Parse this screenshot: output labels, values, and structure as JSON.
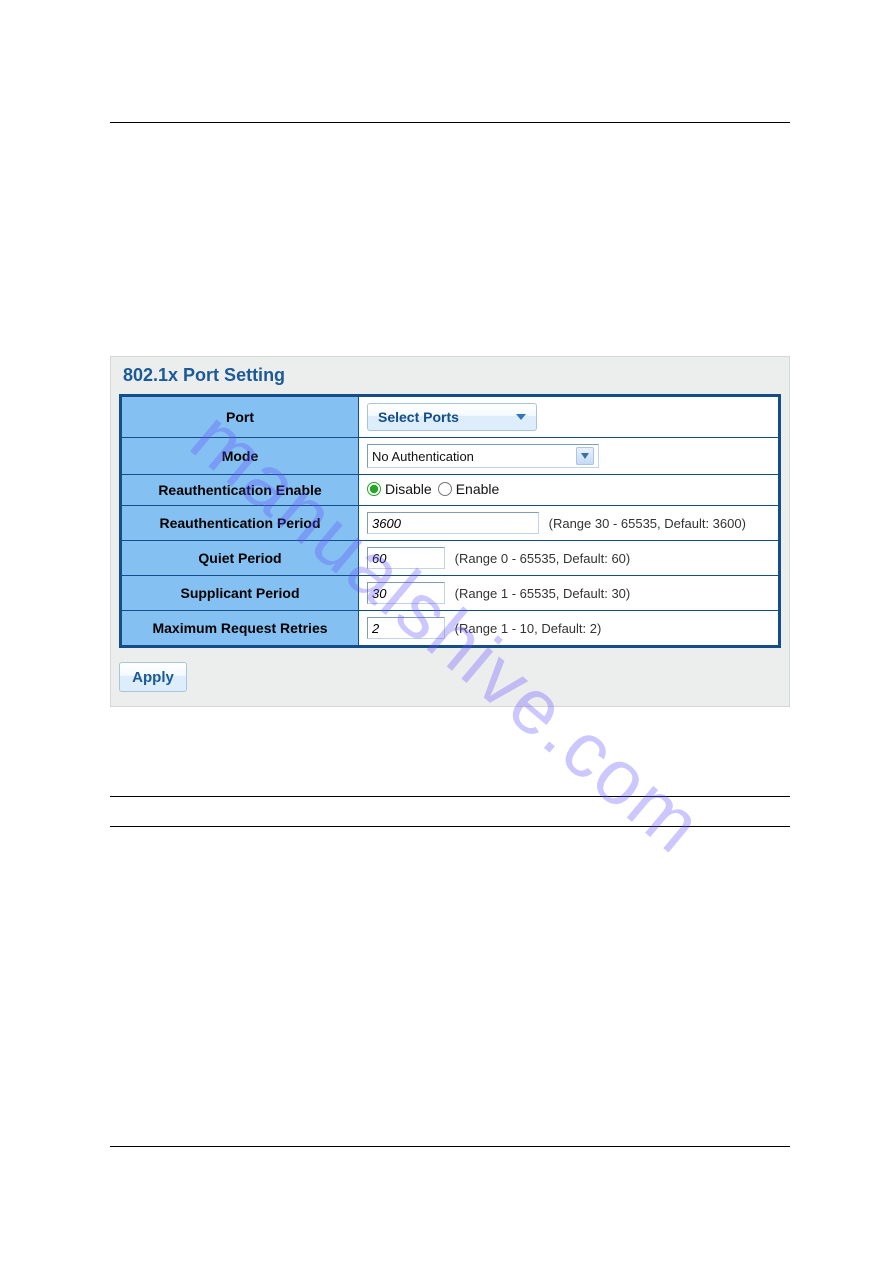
{
  "watermark": "manualshive.com",
  "panel": {
    "title": "802.1x Port Setting",
    "rows": {
      "port": {
        "label": "Port",
        "button_text": "Select Ports"
      },
      "mode": {
        "label": "Mode",
        "value": "No Authentication"
      },
      "reauth_enable": {
        "label": "Reauthentication Enable",
        "disable_label": "Disable",
        "enable_label": "Enable",
        "selected": "disable"
      },
      "reauth_period": {
        "label": "Reauthentication Period",
        "value": "3600",
        "hint": "(Range 30 - 65535, Default: 3600)"
      },
      "quiet_period": {
        "label": "Quiet Period",
        "value": "60",
        "hint": "(Range 0 - 65535, Default: 60)"
      },
      "supplicant_period": {
        "label": "Supplicant Period",
        "value": "30",
        "hint": "(Range 1 - 65535, Default: 30)"
      },
      "max_retries": {
        "label": "Maximum Request Retries",
        "value": "2",
        "hint": "(Range 1 - 10, Default: 2)"
      }
    },
    "apply_label": "Apply"
  },
  "field_widths": {
    "reauth_period": "172px",
    "quiet_period": "78px",
    "supplicant_period": "78px",
    "max_retries": "78px"
  }
}
